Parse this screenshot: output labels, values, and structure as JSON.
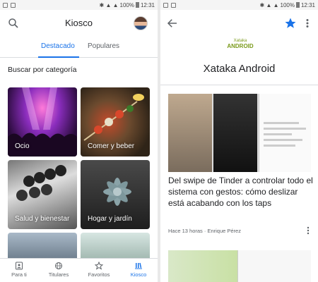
{
  "status_bar": {
    "battery": "100%",
    "time": "12:31"
  },
  "left_screen": {
    "app_title": "Kiosco",
    "tabs": [
      "Destacado",
      "Populares"
    ],
    "section_heading": "Buscar por categoría",
    "categories": [
      "Ocio",
      "Comer y beber",
      "Salud y bienestar",
      "Hogar y jardín"
    ],
    "nav": [
      {
        "label": "Para ti",
        "icon": "person-icon"
      },
      {
        "label": "Titulares",
        "icon": "globe-icon"
      },
      {
        "label": "Favoritos",
        "icon": "star-outline-icon"
      },
      {
        "label": "Kiosco",
        "icon": "newsstand-icon",
        "active": true
      }
    ],
    "accent_color": "#1a73e8"
  },
  "right_screen": {
    "logo_text": "Xataka",
    "logo_accent": "ANDROID",
    "publication_name": "Xataka Android",
    "article": {
      "title": "Del swipe de Tinder a controlar todo el sistema con gestos: cómo deslizar está acabando con los taps",
      "meta": "Hace 13 horas · Enrique Pérez"
    },
    "star_color": "#1a73e8"
  }
}
